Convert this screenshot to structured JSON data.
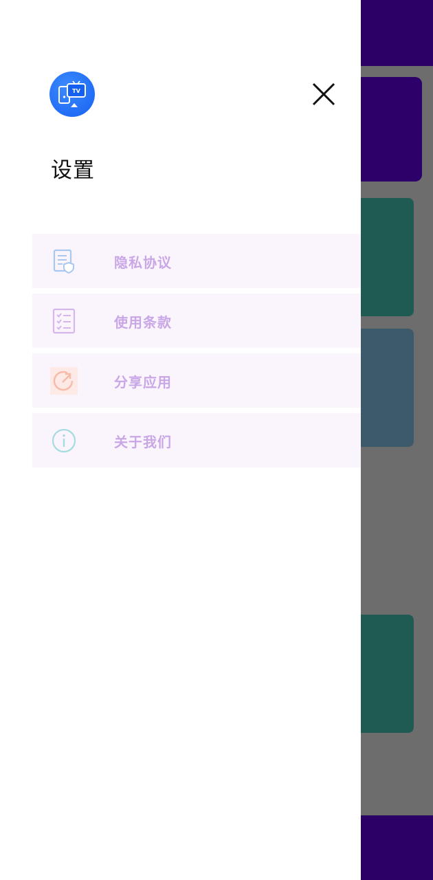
{
  "drawer": {
    "title": "设置",
    "logo_icon": "tv-cast-app-icon",
    "close_icon": "close-icon"
  },
  "menu": {
    "items": [
      {
        "label": "隐私协议",
        "icon": "privacy-document-shield-icon",
        "icon_color": "#a9c8f0"
      },
      {
        "label": "使用条款",
        "icon": "checklist-icon",
        "icon_color": "#d7b6ee"
      },
      {
        "label": "分享应用",
        "icon": "share-arrow-icon",
        "icon_color": "#f7b9a8"
      },
      {
        "label": "关于我们",
        "icon": "info-icon",
        "icon_color": "#a6dbe0"
      }
    ]
  },
  "colors": {
    "menu_text": "#c9a6e6",
    "menu_bg": "#faf5fd",
    "logo_blue": "#1560f0",
    "background_purple": "#2b0066"
  }
}
